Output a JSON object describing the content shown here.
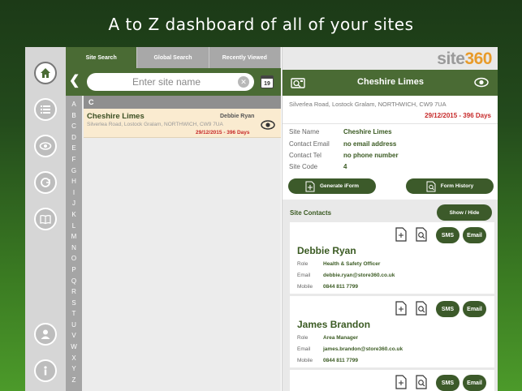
{
  "headline": "A to Z dashboard of all of your sites",
  "tabs": [
    {
      "label": "Site Search",
      "active": true
    },
    {
      "label": "Global Search",
      "active": false
    },
    {
      "label": "Recently Viewed",
      "active": false
    }
  ],
  "search": {
    "placeholder": "Enter site name",
    "value": "",
    "calendar_day": "19"
  },
  "alphabet": [
    "A",
    "B",
    "C",
    "D",
    "E",
    "F",
    "G",
    "H",
    "I",
    "J",
    "K",
    "L",
    "M",
    "N",
    "O",
    "P",
    "Q",
    "R",
    "S",
    "T",
    "U",
    "V",
    "W",
    "X",
    "Y",
    "Z"
  ],
  "list": {
    "section": "C",
    "rows": [
      {
        "name": "Cheshire Limes",
        "contact": "Debbie Ryan",
        "address": "Silverlea Road, Lostock Gralam, NORTHWICH, CW9 7UA",
        "date": "29/12/2015 - 396 Days"
      }
    ]
  },
  "brand": {
    "site": "site",
    "num": "360"
  },
  "detail": {
    "title": "Cheshire Limes",
    "address": "Silverlea Road, Lostock Gralam, NORTHWICH, CW9 7UA",
    "date": "29/12/2015 - 396 Days",
    "fields": [
      {
        "key": "Site Name",
        "value": "Cheshire Limes"
      },
      {
        "key": "Contact Email",
        "value": "no email address"
      },
      {
        "key": "Contact Tel",
        "value": "no phone number"
      },
      {
        "key": "Site Code",
        "value": "4"
      }
    ],
    "generate_label": "Generate iForm",
    "history_label": "Form History",
    "contacts_title": "Site Contacts",
    "show_hide_label": "Show / Hide",
    "contacts": [
      {
        "name": "Debbie Ryan",
        "role_key": "Role",
        "role": "Health & Safety Officer",
        "email_key": "Email",
        "email": "debbie.ryan@store360.co.uk",
        "mobile_key": "Mobile",
        "mobile": "0844 811 7799",
        "sms": "SMS",
        "email_btn": "Email"
      },
      {
        "name": "James Brandon",
        "role_key": "Role",
        "role": "Area Manager",
        "email_key": "Email",
        "email": "james.brandon@store360.co.uk",
        "mobile_key": "Mobile",
        "mobile": "0844 811 7799",
        "sms": "SMS",
        "email_btn": "Email"
      },
      {
        "sms": "SMS",
        "email_btn": "Email"
      }
    ]
  },
  "colors": {
    "primary_green": "#4a6b34",
    "button_green": "#3c5a2a",
    "highlight_row": "#faebd0",
    "alert_red": "#c62828",
    "brand_orange": "#e89b2a"
  },
  "rail_icons": [
    "home-icon",
    "list-icon",
    "eye-icon",
    "sync-icon",
    "book-icon",
    "user-icon",
    "info-icon"
  ]
}
